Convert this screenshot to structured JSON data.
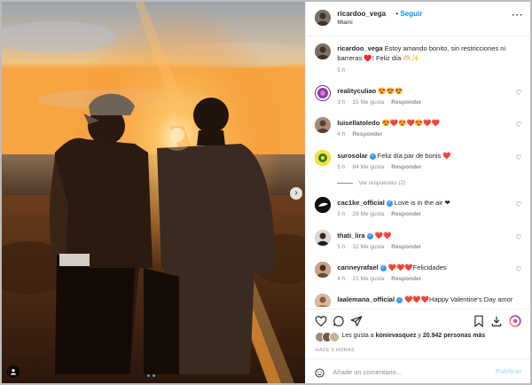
{
  "post": {
    "author": "ricardoo_vega",
    "separator": "•",
    "follow_label": "Seguir",
    "location": "Miami",
    "more_icon": "more-horizontal-icon"
  },
  "caption": {
    "username": "ricardoo_vega",
    "text": "Estoy amando bonito, sin restricciones ni barreras ♥️! Feliz día 🫶🏻✨",
    "time": "5 h"
  },
  "comments": [
    {
      "username": "realityculiao",
      "verified": false,
      "text": "😍😍😍",
      "time": "3 h",
      "likes": "15 Me gusta",
      "reply": "Responder"
    },
    {
      "username": "luisellatoledo",
      "verified": false,
      "text": "😍❤️😍❤️😍❤️❤️",
      "time": "4 h",
      "likes": "",
      "reply": "Responder"
    },
    {
      "username": "surosolar",
      "verified": true,
      "text": "Feliz día par de bonis ❤️",
      "time": "5 h",
      "likes": "64 Me gusta",
      "reply": "Responder",
      "view_replies": "Ver respuestas (2)"
    },
    {
      "username": "cac1ke_official",
      "verified": true,
      "text": "Love is in the air ❤",
      "time": "5 h",
      "likes": "29 Me gusta",
      "reply": "Responder"
    },
    {
      "username": "thati_lira",
      "verified": true,
      "text": "❤️❤️",
      "time": "5 h",
      "likes": "32 Me gusta",
      "reply": "Responder"
    },
    {
      "username": "carineyrafael",
      "verified": true,
      "text": "❤️❤️❤️Felicidades",
      "time": "4 h",
      "likes": "21 Me gusta",
      "reply": "Responder"
    },
    {
      "username": "laalemana_official",
      "verified": true,
      "text": "❤️❤️❤️Happy Valentine's Day amor",
      "time": "",
      "likes": "",
      "reply": ""
    }
  ],
  "actions": {
    "like_icon": "heart-icon",
    "comment_icon": "comment-icon",
    "share_icon": "send-icon",
    "save_icon": "bookmark-icon",
    "download_icon": "download-icon",
    "extra_icon": "instagram-gradient-icon"
  },
  "likes_summary": {
    "prefix": "Les gusta a ",
    "user": "konievasquez",
    "middle": " y ",
    "count": "20.942 personas más"
  },
  "posted_ago": "HACE 5 HORAS",
  "add_comment": {
    "placeholder": "Añade un comentario...",
    "post_label": "Publicar"
  },
  "colors": {
    "accent": "#0095f6",
    "verified": "#3897f0",
    "heart_red": "#ed4956",
    "muted": "#8e8e8e",
    "publish_disabled": "#b2dffc"
  }
}
